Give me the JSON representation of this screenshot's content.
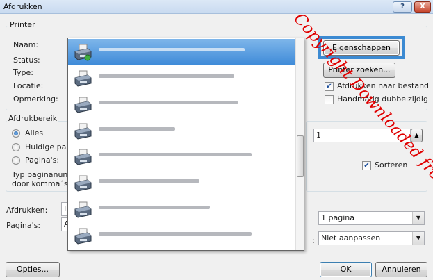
{
  "window": {
    "title": "Afdrukken",
    "help_label": "?",
    "close_label": "X"
  },
  "printer_group": {
    "label": "Printer",
    "name_label": "Naam:",
    "status_label": "Status:",
    "type_label": "Type:",
    "location_label": "Locatie:",
    "comment_label": "Opmerking:",
    "properties_button": "Eigenschappen",
    "find_printer_button": "Printer zoeken...",
    "print_to_file_label": "Afdrukken naar bestand",
    "manual_duplex_label": "Handmatig dubbelzijdig",
    "print_to_file_checked": true,
    "manual_duplex_checked": false
  },
  "printer_dropdown": {
    "items": [
      {
        "icon": "network-printer-icon",
        "selected": true
      },
      {
        "icon": "printer-icon",
        "selected": false
      },
      {
        "icon": "printer-icon",
        "selected": false
      },
      {
        "icon": "printer-icon",
        "selected": false
      },
      {
        "icon": "printer-icon",
        "selected": false
      },
      {
        "icon": "printer-icon",
        "selected": false
      },
      {
        "icon": "printer-icon",
        "selected": false
      },
      {
        "icon": "printer-icon",
        "selected": false
      }
    ]
  },
  "range_group": {
    "label": "Afdrukbereik",
    "all_label": "Alles",
    "current_page_label": "Huidige pa",
    "pages_label": "Pagina's:",
    "hint_line1": "Typ paginanun",
    "hint_line2": "door komma´s",
    "selected": "all"
  },
  "copies": {
    "value": "1",
    "collate_label": "Sorteren",
    "collate_checked": true
  },
  "bottom": {
    "print_what_label": "Afdrukken:",
    "print_what_value": "D",
    "pages_label": "Pagina's:",
    "pages_value": "A",
    "pages_per_sheet_value": "1 pagina",
    "scale_value": "Niet aanpassen",
    "colon": ":"
  },
  "footer": {
    "options_button": "Opties...",
    "ok_button": "OK",
    "cancel_button": "Annuleren"
  },
  "watermark": "Copyright Downloaded from www.vandenborre.be",
  "colors": {
    "highlight": "#3c8ad2",
    "watermark": "#e00000",
    "selection": "#3e8ad8"
  }
}
